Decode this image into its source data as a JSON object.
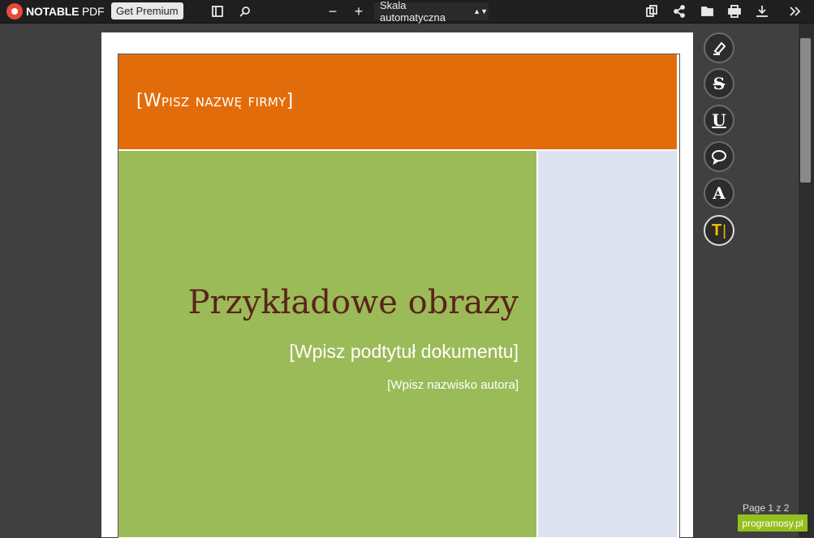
{
  "toolbar": {
    "logo_bold": "NOTABLE",
    "logo_light": " PDF",
    "premium_label": "Get Premium",
    "scale_label": "Skala automatyczna",
    "zoom_out": "−",
    "zoom_in": "+"
  },
  "document": {
    "company": "[Wpisz nazwę firmy]",
    "title": "Przykładowe obrazy",
    "subtitle": "[Wpisz podtytuł dokumentu]",
    "author": "[Wpisz nazwisko autora]"
  },
  "annotation_tools": {
    "strike_label": "S",
    "underline_label": "U",
    "text_label": "A",
    "text_box_label": "T"
  },
  "status": {
    "page_info": "Page 1 z 2",
    "watermark": "programosy.pl"
  },
  "colors": {
    "header_orange": "#e36c0a",
    "cover_green": "#9bbb59",
    "side_blue": "#dce2ef",
    "title_brown": "#5b2418",
    "watermark_green": "#94c01f"
  }
}
